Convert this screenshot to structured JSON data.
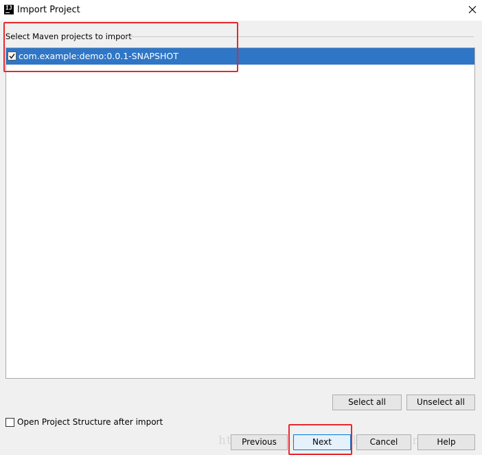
{
  "window": {
    "title": "Import Project",
    "icon": "intellij-icon",
    "icon_letter": "IJ"
  },
  "panel": {
    "label": "Select Maven projects to import"
  },
  "projects": [
    {
      "label": "com.example:demo:0.0.1-SNAPSHOT",
      "checked": true,
      "selected": true
    }
  ],
  "buttons": {
    "select_all": "Select all",
    "unselect_all": "Unselect all",
    "previous": "Previous",
    "next": "Next",
    "cancel": "Cancel",
    "help": "Help"
  },
  "options": {
    "open_structure_label": "Open Project Structure after import",
    "open_structure_checked": false
  },
  "watermark": "http://blog.csdn.net/ldyongpeng113",
  "colors": {
    "selection": "#2f76c6",
    "annotation": "#e8262a",
    "primary_border": "#0078d7"
  }
}
